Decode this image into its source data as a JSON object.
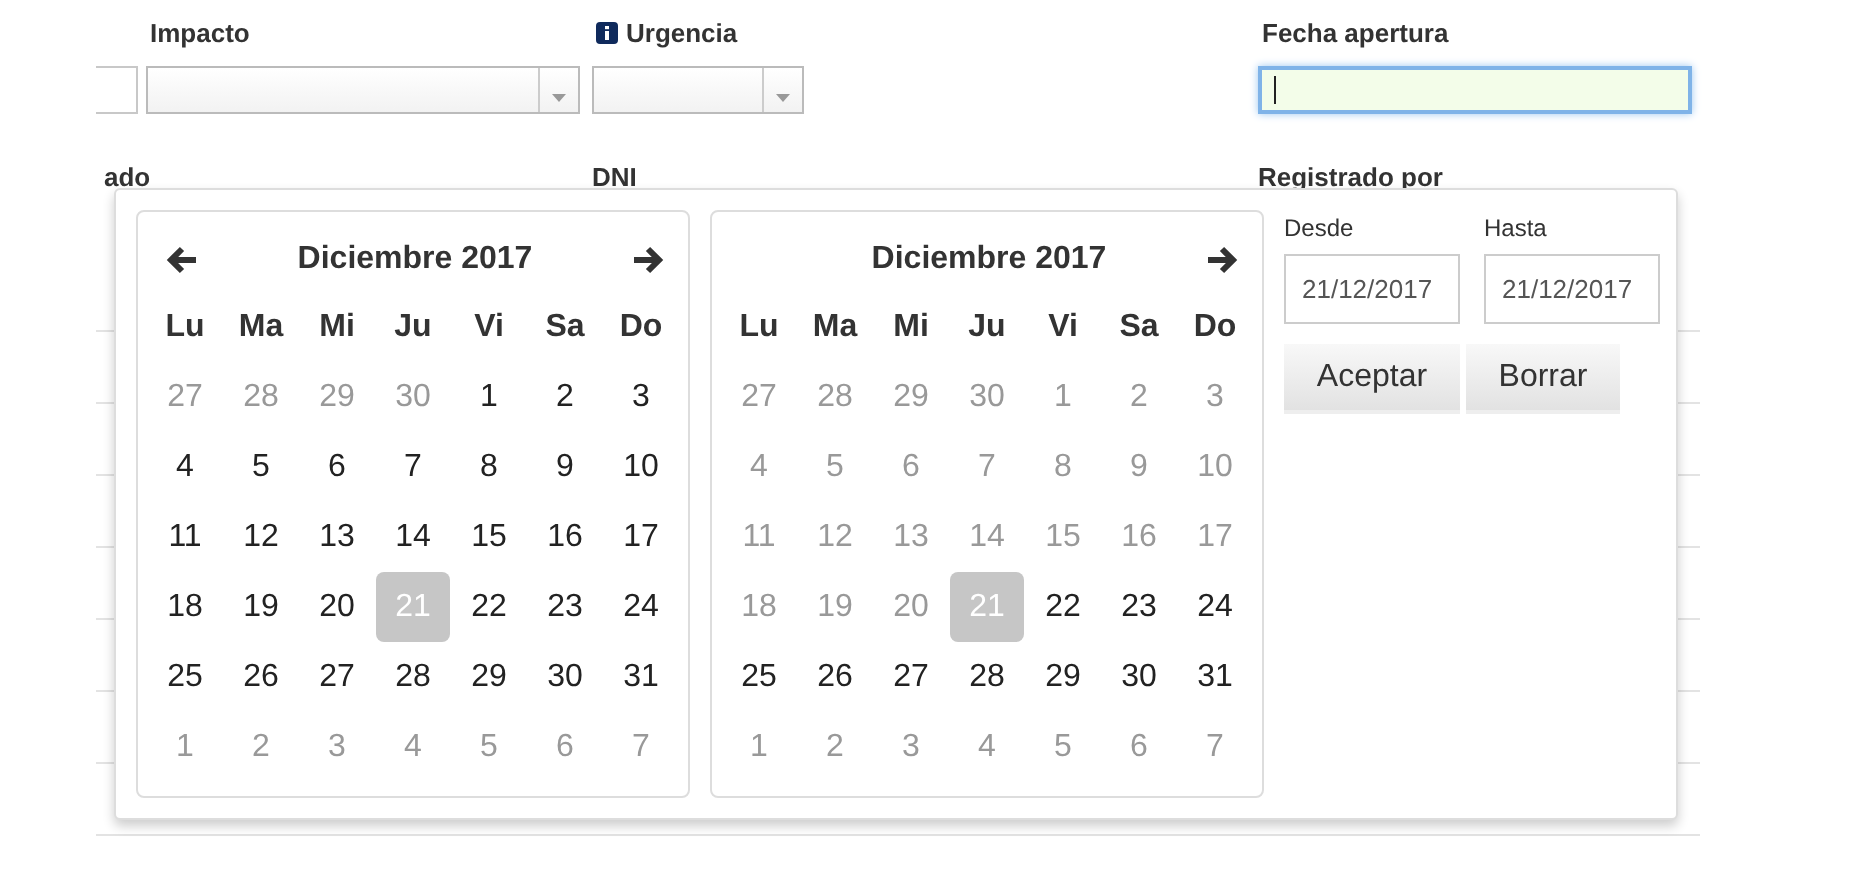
{
  "form": {
    "row1": [
      {
        "kind": "cut"
      },
      {
        "kind": "select",
        "label": "Impacto"
      },
      {
        "kind": "select-info",
        "label": "Urgencia"
      },
      {
        "kind": "input",
        "label": "Fecha apertura",
        "focused": true
      }
    ],
    "row2": [
      {
        "label": "ado"
      },
      {
        "label": "DNI"
      },
      {
        "label": "Registrado por"
      }
    ]
  },
  "calendars": [
    {
      "title": "Diciembre 2017",
      "prev": true,
      "next": true,
      "weekdays": [
        "Lu",
        "Ma",
        "Mi",
        "Ju",
        "Vi",
        "Sa",
        "Do"
      ],
      "weeks": [
        [
          {
            "d": "27",
            "off": true,
            "selected": false
          },
          {
            "d": "28",
            "off": true,
            "selected": false
          },
          {
            "d": "29",
            "off": true,
            "selected": false
          },
          {
            "d": "30",
            "off": true,
            "selected": false
          },
          {
            "d": "1",
            "off": false,
            "selected": false
          },
          {
            "d": "2",
            "off": false,
            "selected": false
          },
          {
            "d": "3",
            "off": false,
            "selected": false
          }
        ],
        [
          {
            "d": "4",
            "off": false,
            "selected": false
          },
          {
            "d": "5",
            "off": false,
            "selected": false
          },
          {
            "d": "6",
            "off": false,
            "selected": false
          },
          {
            "d": "7",
            "off": false,
            "selected": false
          },
          {
            "d": "8",
            "off": false,
            "selected": false
          },
          {
            "d": "9",
            "off": false,
            "selected": false
          },
          {
            "d": "10",
            "off": false,
            "selected": false
          }
        ],
        [
          {
            "d": "11",
            "off": false,
            "selected": false
          },
          {
            "d": "12",
            "off": false,
            "selected": false
          },
          {
            "d": "13",
            "off": false,
            "selected": false
          },
          {
            "d": "14",
            "off": false,
            "selected": false
          },
          {
            "d": "15",
            "off": false,
            "selected": false
          },
          {
            "d": "16",
            "off": false,
            "selected": false
          },
          {
            "d": "17",
            "off": false,
            "selected": false
          }
        ],
        [
          {
            "d": "18",
            "off": false,
            "selected": false
          },
          {
            "d": "19",
            "off": false,
            "selected": false
          },
          {
            "d": "20",
            "off": false,
            "selected": false
          },
          {
            "d": "21",
            "off": false,
            "selected": true
          },
          {
            "d": "22",
            "off": false,
            "selected": false
          },
          {
            "d": "23",
            "off": false,
            "selected": false
          },
          {
            "d": "24",
            "off": false,
            "selected": false
          }
        ],
        [
          {
            "d": "25",
            "off": false,
            "selected": false
          },
          {
            "d": "26",
            "off": false,
            "selected": false
          },
          {
            "d": "27",
            "off": false,
            "selected": false
          },
          {
            "d": "28",
            "off": false,
            "selected": false
          },
          {
            "d": "29",
            "off": false,
            "selected": false
          },
          {
            "d": "30",
            "off": false,
            "selected": false
          },
          {
            "d": "31",
            "off": false,
            "selected": false
          }
        ],
        [
          {
            "d": "1",
            "off": true,
            "selected": false
          },
          {
            "d": "2",
            "off": true,
            "selected": false
          },
          {
            "d": "3",
            "off": true,
            "selected": false
          },
          {
            "d": "4",
            "off": true,
            "selected": false
          },
          {
            "d": "5",
            "off": true,
            "selected": false
          },
          {
            "d": "6",
            "off": true,
            "selected": false
          },
          {
            "d": "7",
            "off": true,
            "selected": false
          }
        ]
      ]
    },
    {
      "title": "Diciembre 2017",
      "prev": false,
      "next": true,
      "weekdays": [
        "Lu",
        "Ma",
        "Mi",
        "Ju",
        "Vi",
        "Sa",
        "Do"
      ],
      "weeks": [
        [
          {
            "d": "27",
            "off": true,
            "selected": false
          },
          {
            "d": "28",
            "off": true,
            "selected": false
          },
          {
            "d": "29",
            "off": true,
            "selected": false
          },
          {
            "d": "30",
            "off": true,
            "selected": false
          },
          {
            "d": "1",
            "off": true,
            "selected": false
          },
          {
            "d": "2",
            "off": true,
            "selected": false
          },
          {
            "d": "3",
            "off": true,
            "selected": false
          }
        ],
        [
          {
            "d": "4",
            "off": true,
            "selected": false
          },
          {
            "d": "5",
            "off": true,
            "selected": false
          },
          {
            "d": "6",
            "off": true,
            "selected": false
          },
          {
            "d": "7",
            "off": true,
            "selected": false
          },
          {
            "d": "8",
            "off": true,
            "selected": false
          },
          {
            "d": "9",
            "off": true,
            "selected": false
          },
          {
            "d": "10",
            "off": true,
            "selected": false
          }
        ],
        [
          {
            "d": "11",
            "off": true,
            "selected": false
          },
          {
            "d": "12",
            "off": true,
            "selected": false
          },
          {
            "d": "13",
            "off": true,
            "selected": false
          },
          {
            "d": "14",
            "off": true,
            "selected": false
          },
          {
            "d": "15",
            "off": true,
            "selected": false
          },
          {
            "d": "16",
            "off": true,
            "selected": false
          },
          {
            "d": "17",
            "off": true,
            "selected": false
          }
        ],
        [
          {
            "d": "18",
            "off": true,
            "selected": false
          },
          {
            "d": "19",
            "off": true,
            "selected": false
          },
          {
            "d": "20",
            "off": true,
            "selected": false
          },
          {
            "d": "21",
            "off": false,
            "selected": true
          },
          {
            "d": "22",
            "off": false,
            "selected": false
          },
          {
            "d": "23",
            "off": false,
            "selected": false
          },
          {
            "d": "24",
            "off": false,
            "selected": false
          }
        ],
        [
          {
            "d": "25",
            "off": false,
            "selected": false
          },
          {
            "d": "26",
            "off": false,
            "selected": false
          },
          {
            "d": "27",
            "off": false,
            "selected": false
          },
          {
            "d": "28",
            "off": false,
            "selected": false
          },
          {
            "d": "29",
            "off": false,
            "selected": false
          },
          {
            "d": "30",
            "off": false,
            "selected": false
          },
          {
            "d": "31",
            "off": false,
            "selected": false
          }
        ],
        [
          {
            "d": "1",
            "off": true,
            "selected": false
          },
          {
            "d": "2",
            "off": true,
            "selected": false
          },
          {
            "d": "3",
            "off": true,
            "selected": false
          },
          {
            "d": "4",
            "off": true,
            "selected": false
          },
          {
            "d": "5",
            "off": true,
            "selected": false
          },
          {
            "d": "6",
            "off": true,
            "selected": false
          },
          {
            "d": "7",
            "off": true,
            "selected": false
          }
        ]
      ]
    }
  ],
  "range": {
    "from": {
      "label": "Desde",
      "value": "21/12/2017"
    },
    "to": {
      "label": "Hasta",
      "value": "21/12/2017"
    },
    "buttons": [
      "Aceptar",
      "Borrar"
    ]
  }
}
